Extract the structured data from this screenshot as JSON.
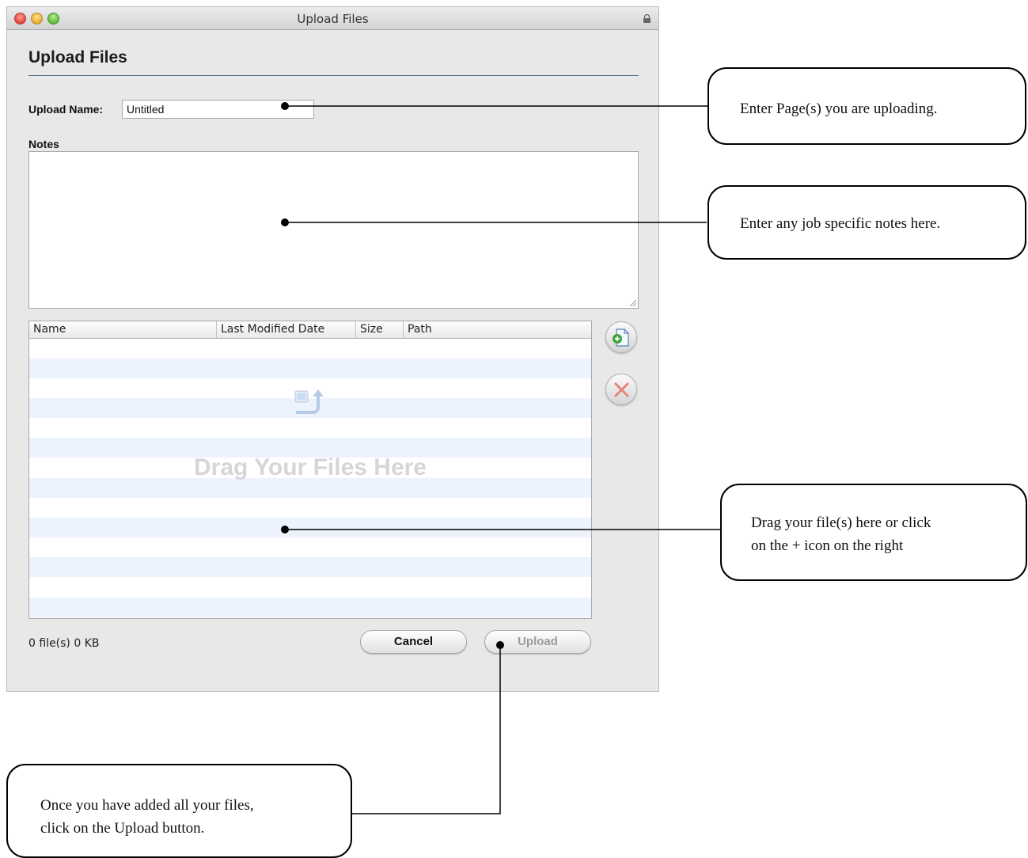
{
  "window": {
    "title": "Upload Files"
  },
  "dialog": {
    "heading": "Upload Files",
    "upload_name_label": "Upload Name:",
    "upload_name_value": "Untitled",
    "notes_label": "Notes",
    "notes_value": ""
  },
  "file_table": {
    "columns": [
      "Name",
      "Last Modified Date",
      "Size",
      "Path"
    ],
    "rows": [],
    "empty_hint": "Drag Your Files Here"
  },
  "side_buttons": {
    "add_icon": "add-file-icon",
    "remove_icon": "remove-x-icon"
  },
  "footer": {
    "status": "0 file(s) 0 KB",
    "cancel_label": "Cancel",
    "upload_label": "Upload"
  },
  "callouts": {
    "upload_name": "Enter Page(s) you are uploading.",
    "notes": "Enter any job specific notes here.",
    "drag_line1": "Drag your file(s) here or click",
    "drag_line2": "on the + icon on the right",
    "upload_line1": "Once you have added all your files,",
    "upload_line2": "click on the Upload button."
  },
  "colors": {
    "heading_rule": "#4a6890",
    "stripe": "#edf3fd",
    "remove_x": "#e8837c",
    "add_plus": "#3aa53a"
  }
}
